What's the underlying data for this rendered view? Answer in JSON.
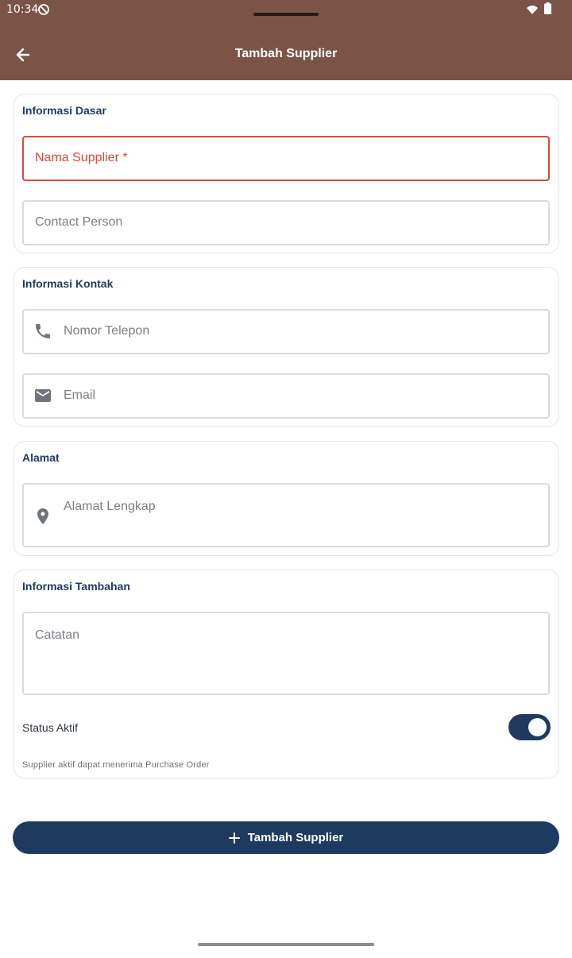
{
  "status_bar": {
    "time": "10:34"
  },
  "header": {
    "title": "Tambah Supplier",
    "back_icon": "arrow-left-icon"
  },
  "sections": {
    "basic": {
      "title": "Informasi Dasar",
      "name_label": "Nama Supplier *",
      "contact_label": "Contact Person"
    },
    "contact": {
      "title": "Informasi Kontak",
      "phone_label": "Nomor Telepon",
      "email_label": "Email"
    },
    "address": {
      "title": "Alamat",
      "address_label": "Alamat Lengkap"
    },
    "extra": {
      "title": "Informasi Tambahan",
      "notes_label": "Catatan",
      "status_label": "Status Aktif",
      "status_on": true,
      "status_helper": "Supplier aktif dapat menerima Purchase Order"
    }
  },
  "submit": {
    "label": "Tambah Supplier",
    "icon": "plus-icon"
  },
  "colors": {
    "appbar": "#7a5446",
    "primary": "#1e3a5f",
    "error": "#d94a3b"
  }
}
